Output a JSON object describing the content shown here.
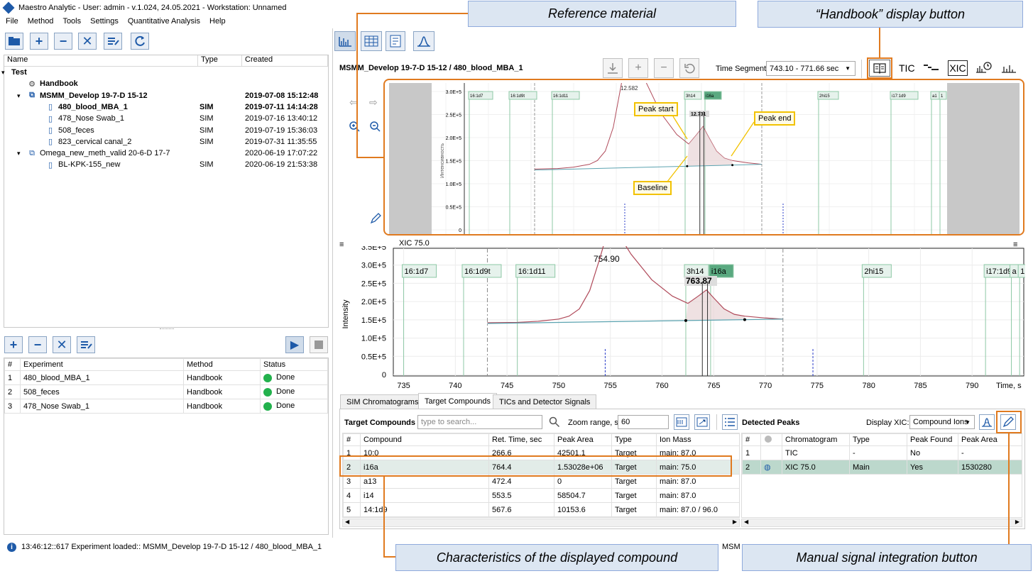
{
  "window": {
    "title": "Maestro Analytic - User: admin - v.1.024, 24.05.2021 - Workstation: Unnamed"
  },
  "menu": [
    "File",
    "Method",
    "Tools",
    "Settings",
    "Quantitative Analysis",
    "Help"
  ],
  "tree": {
    "headers": [
      "Name",
      "Type",
      "Created"
    ],
    "rows": [
      {
        "name": "Test",
        "type": "",
        "created": ""
      },
      {
        "name": "Handbook",
        "type": "",
        "created": ""
      },
      {
        "name": "MSMM_Develop 19-7-D 15-12",
        "type": "",
        "created": "2019-07-08 15:12:48"
      },
      {
        "name": "480_blood_MBA_1",
        "type": "SIM",
        "created": "2019-07-11 14:14:28"
      },
      {
        "name": "478_Nose Swab_1",
        "type": "SIM",
        "created": "2019-07-16 13:40:12"
      },
      {
        "name": "508_feces",
        "type": "SIM",
        "created": "2019-07-19 15:36:03"
      },
      {
        "name": "823_cervical canal_2",
        "type": "SIM",
        "created": "2019-07-31 11:35:55"
      },
      {
        "name": "Omega_new_meth_valid 20-6-D 17-7",
        "type": "",
        "created": "2020-06-19 17:07:22"
      },
      {
        "name": "BL-KPK-155_new",
        "type": "SIM",
        "created": "2020-06-19 21:53:38"
      }
    ]
  },
  "experiments": {
    "headers": [
      "#",
      "Experiment",
      "Method",
      "Status"
    ],
    "rows": [
      {
        "n": "1",
        "experiment": "480_blood_MBA_1",
        "method": "Handbook",
        "status": "Done"
      },
      {
        "n": "2",
        "experiment": "508_feces",
        "method": "Handbook",
        "status": "Done"
      },
      {
        "n": "3",
        "experiment": "478_Nose Swab_1",
        "method": "Handbook",
        "status": "Done"
      }
    ]
  },
  "status_bar": {
    "message": "13:46:12::617 Experiment loaded:: MSMM_Develop 19-7-D 15-12 / 480_blood_MBA_1",
    "overflow": "MSM"
  },
  "main": {
    "title": "MSMM_Develop 19-7-D 15-12 / 480_blood_MBA_1",
    "time_segment_label": "Time Segment",
    "time_segment_value": "743.10 - 771.66 sec",
    "tic_label": "TIC",
    "xic_label": "XIC"
  },
  "reference_chart": {
    "ylabel": "Интенсивность",
    "yticks": [
      "3.0E+5",
      "2.5E+5",
      "2.0E+5",
      "1.5E+5",
      "1.0E+5",
      "0.5E+5",
      "0"
    ],
    "top_label": "12.582",
    "peak_label": "12.731",
    "markers": [
      "16:1d7",
      "16:1d9t",
      "16:1d11",
      "3h14",
      "i16a",
      "2hi15",
      "i17:1d9",
      "a1",
      "1"
    ],
    "annotations": {
      "peak_start": "Peak start",
      "peak_end": "Peak end",
      "baseline": "Baseline"
    }
  },
  "chart_data": {
    "type": "line",
    "title": "XIC 75.0",
    "xlabel": "Time, s",
    "ylabel": "Intensity",
    "xlim": [
      734,
      795
    ],
    "ylim": [
      0,
      350000
    ],
    "xticks": [
      735,
      740,
      745,
      750,
      755,
      760,
      765,
      770,
      775,
      780,
      785,
      790
    ],
    "ytick_labels": [
      "3.5E+5",
      "3.0E+5",
      "2.5E+5",
      "2.0E+5",
      "1.5E+5",
      "1.0E+5",
      "0.5E+5",
      "0"
    ],
    "top_label": "754.90",
    "peak_label": "763.87",
    "markers": [
      "16:1d7",
      "16:1d9t",
      "16:1d11",
      "3h14",
      "i16a",
      "2hi15",
      "i17:1d9",
      "a",
      "1"
    ],
    "series": [
      {
        "name": "XIC 75.0",
        "x": [
          743.1,
          746,
          748,
          750,
          751,
          752,
          753,
          754,
          755,
          757,
          759,
          761,
          762.5,
          763.5,
          764.3,
          765,
          766,
          767,
          768,
          770,
          771.7
        ],
        "y": [
          142000,
          143000,
          146000,
          152000,
          160000,
          180000,
          230000,
          320000,
          420000,
          330000,
          260000,
          215000,
          195000,
          215000,
          232000,
          210000,
          180000,
          165000,
          160000,
          155000,
          152000
        ]
      },
      {
        "name": "Baseline",
        "x": [
          743.1,
          771.7
        ],
        "y": [
          140000,
          152000
        ]
      }
    ]
  },
  "tabs": [
    "SIM Chromatograms",
    "Target Compounds",
    "TICs and Detector Signals"
  ],
  "target_compounds": {
    "label": "Target Compounds",
    "search_placeholder": "type to search...",
    "zoom_label": "Zoom range, s",
    "zoom_value": "60",
    "headers": [
      "#",
      "Compound",
      "Ret. Time, sec",
      "Peak Area",
      "Type",
      "Ion Mass"
    ],
    "rows": [
      {
        "n": "1",
        "compound": "10:0",
        "rt": "266.6",
        "area": "42501.1",
        "type": "Target",
        "ion": "main: 87.0"
      },
      {
        "n": "2",
        "compound": "i16a",
        "rt": "764.4",
        "area": "1.53028e+06",
        "type": "Target",
        "ion": "main: 75.0"
      },
      {
        "n": "3",
        "compound": "a13",
        "rt": "472.4",
        "area": "0",
        "type": "Target",
        "ion": "main: 87.0"
      },
      {
        "n": "4",
        "compound": "i14",
        "rt": "553.5",
        "area": "58504.7",
        "type": "Target",
        "ion": "main: 87.0"
      },
      {
        "n": "5",
        "compound": "14:1d9",
        "rt": "567.6",
        "area": "10153.6",
        "type": "Target",
        "ion": "main: 87.0 / 96.0"
      }
    ]
  },
  "detected_peaks": {
    "label": "Detected Peaks",
    "display_xic_label": "Display XIC:",
    "display_xic_value": "Compound Ions",
    "headers": [
      "#",
      "",
      "Chromatogram",
      "Type",
      "Peak Found",
      "Peak Area"
    ],
    "rows": [
      {
        "n": "1",
        "chrom": "TIC",
        "type": "-",
        "found": "No",
        "area": "-"
      },
      {
        "n": "2",
        "chrom": "XIC 75.0",
        "type": "Main",
        "found": "Yes",
        "area": "1530280"
      }
    ]
  },
  "callouts": {
    "reference": "Reference material",
    "handbook": "“Handbook” display button",
    "characteristics": "Characteristics of the displayed compound",
    "manual": "Manual signal integration button"
  },
  "colors": {
    "accent": "#e07a1f",
    "callout_bg": "#dce6f2",
    "curve": "#b04a5a",
    "baseline": "#5ba3b0",
    "marker_fill": "#e6f2ec",
    "selected_row": "#e2ece8"
  }
}
